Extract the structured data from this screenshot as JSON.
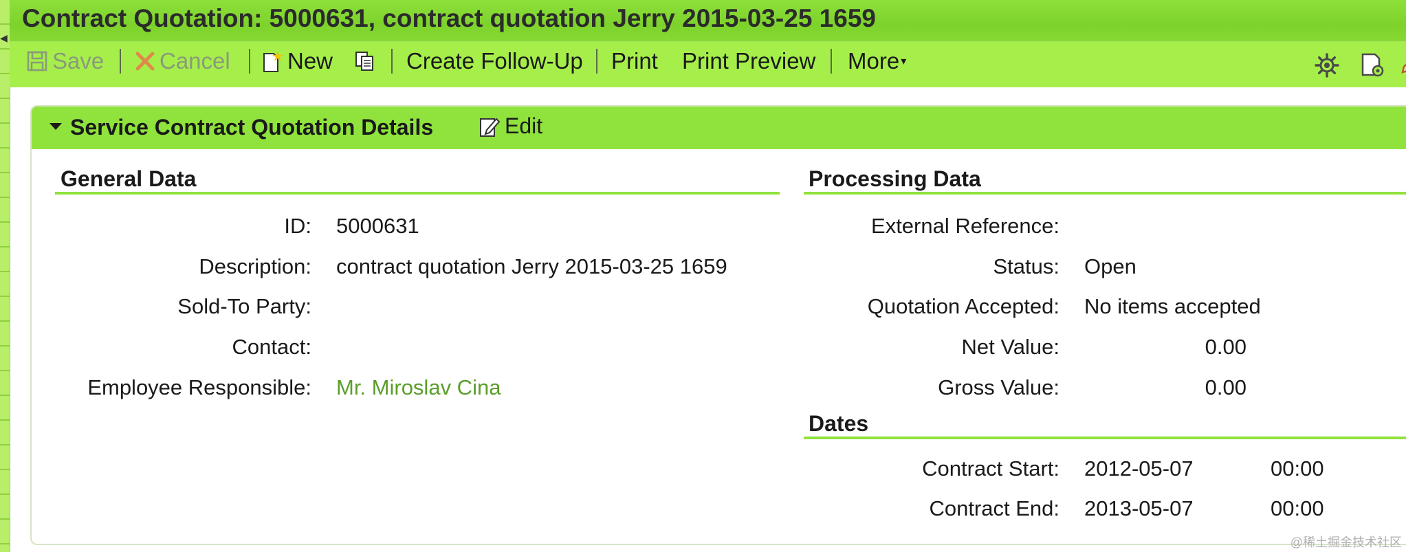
{
  "window": {
    "title": "Contract Quotation: 5000631, contract quotation Jerry 2015-03-25 1659"
  },
  "toolbar": {
    "save_label": "Save",
    "cancel_label": "Cancel",
    "new_label": "New",
    "create_follow_up_label": "Create Follow-Up",
    "print_label": "Print",
    "print_preview_label": "Print Preview",
    "more_label": "More"
  },
  "panel": {
    "title": "Service Contract Quotation Details",
    "edit_label": "Edit"
  },
  "general_data": {
    "heading": "General Data",
    "rows": [
      {
        "label": "ID:",
        "value": "5000631"
      },
      {
        "label": "Description:",
        "value": "contract quotation Jerry 2015-03-25 1659"
      },
      {
        "label": "Sold-To Party:",
        "value": ""
      },
      {
        "label": "Contact:",
        "value": ""
      },
      {
        "label": "Employee Responsible:",
        "value": "Mr. Miroslav Cina"
      }
    ]
  },
  "processing_data": {
    "heading": "Processing Data",
    "rows": [
      {
        "label": "External Reference:",
        "value": ""
      },
      {
        "label": "Status:",
        "value": "Open"
      },
      {
        "label": "Quotation Accepted:",
        "value": "No items accepted"
      },
      {
        "label": "Net Value:",
        "value": "0.00"
      },
      {
        "label": "Gross Value:",
        "value": "0.00"
      }
    ]
  },
  "dates": {
    "heading": "Dates",
    "rows": [
      {
        "label": "Contract Start:",
        "date": "2012-05-07",
        "time": "00:00"
      },
      {
        "label": "Contract End:",
        "date": "2013-05-07",
        "time": "00:00"
      }
    ]
  },
  "watermark": "@稀土掘金技术社区",
  "colors": {
    "title_bar": "#7ed22c",
    "toolbar": "#a6ef4a",
    "panel_header": "#8fe33c",
    "link": "#5a9e2a"
  }
}
